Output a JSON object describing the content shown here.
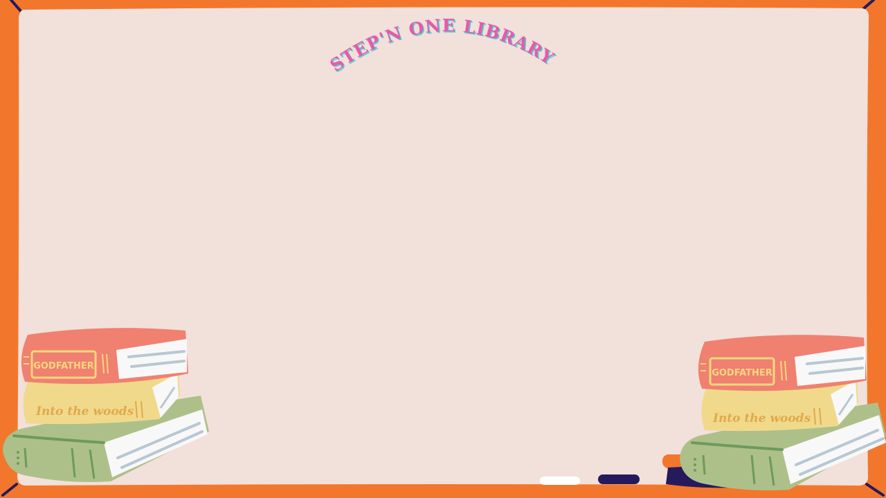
{
  "page": {
    "title": "STEP'N ONE LIBRARY",
    "colors": {
      "frame": "#f2772c",
      "board": "#f2e0da",
      "navy": "#251a5c",
      "title_pink": "#e85aa8",
      "title_cyan": "#46d0d8",
      "book_red": "#f08070",
      "book_yellow": "#f1d98c",
      "book_green": "#adc08a",
      "pages": "#f8f8f8",
      "label_gold": "#e8b84a"
    }
  },
  "books_left": [
    {
      "title": "GODFATHER",
      "color": "red"
    },
    {
      "title": "Into the woods",
      "color": "yellow"
    },
    {
      "title": "",
      "color": "green"
    }
  ],
  "books_right": [
    {
      "title": "GODFATHER",
      "color": "red"
    },
    {
      "title": "Into the woods",
      "color": "yellow"
    },
    {
      "title": "",
      "color": "green"
    }
  ]
}
